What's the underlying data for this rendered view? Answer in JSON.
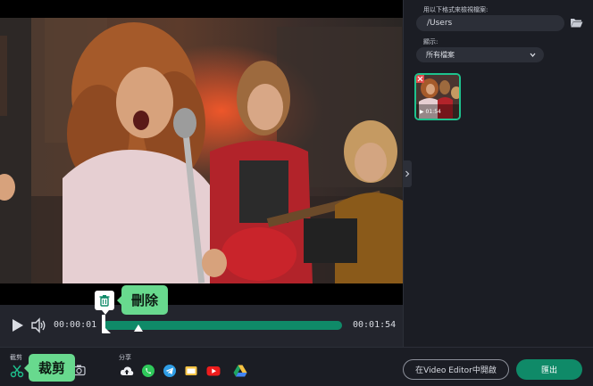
{
  "player": {
    "current_time": "00:00:01",
    "total_time": "00:01:54",
    "trim_fraction": 1.0
  },
  "tooltips": {
    "delete_label": "刪除",
    "cut_label": "裁剪"
  },
  "bottom_bar": {
    "trim_section_label": "截剪",
    "share_section_label": "分享",
    "share_icons": [
      "cloud-upload-icon",
      "whatsapp-icon",
      "telegram-icon",
      "folder-share-icon",
      "youtube-icon",
      "google-drive-icon"
    ],
    "open_in_editor_label": "在Video Editor中開啟",
    "export_label": "匯出"
  },
  "right_panel": {
    "folder_label": "用以下格式來檢視檔案:",
    "folder_path": "/Users",
    "show_label": "顯示:",
    "filter_value": "所有檔案",
    "thumbnail": {
      "duration": "01:54"
    }
  },
  "colors": {
    "accent_green": "#0f8a68",
    "tooltip_green": "#68d98e",
    "thumb_border": "#1ec28e",
    "background": "#1b1d24"
  }
}
